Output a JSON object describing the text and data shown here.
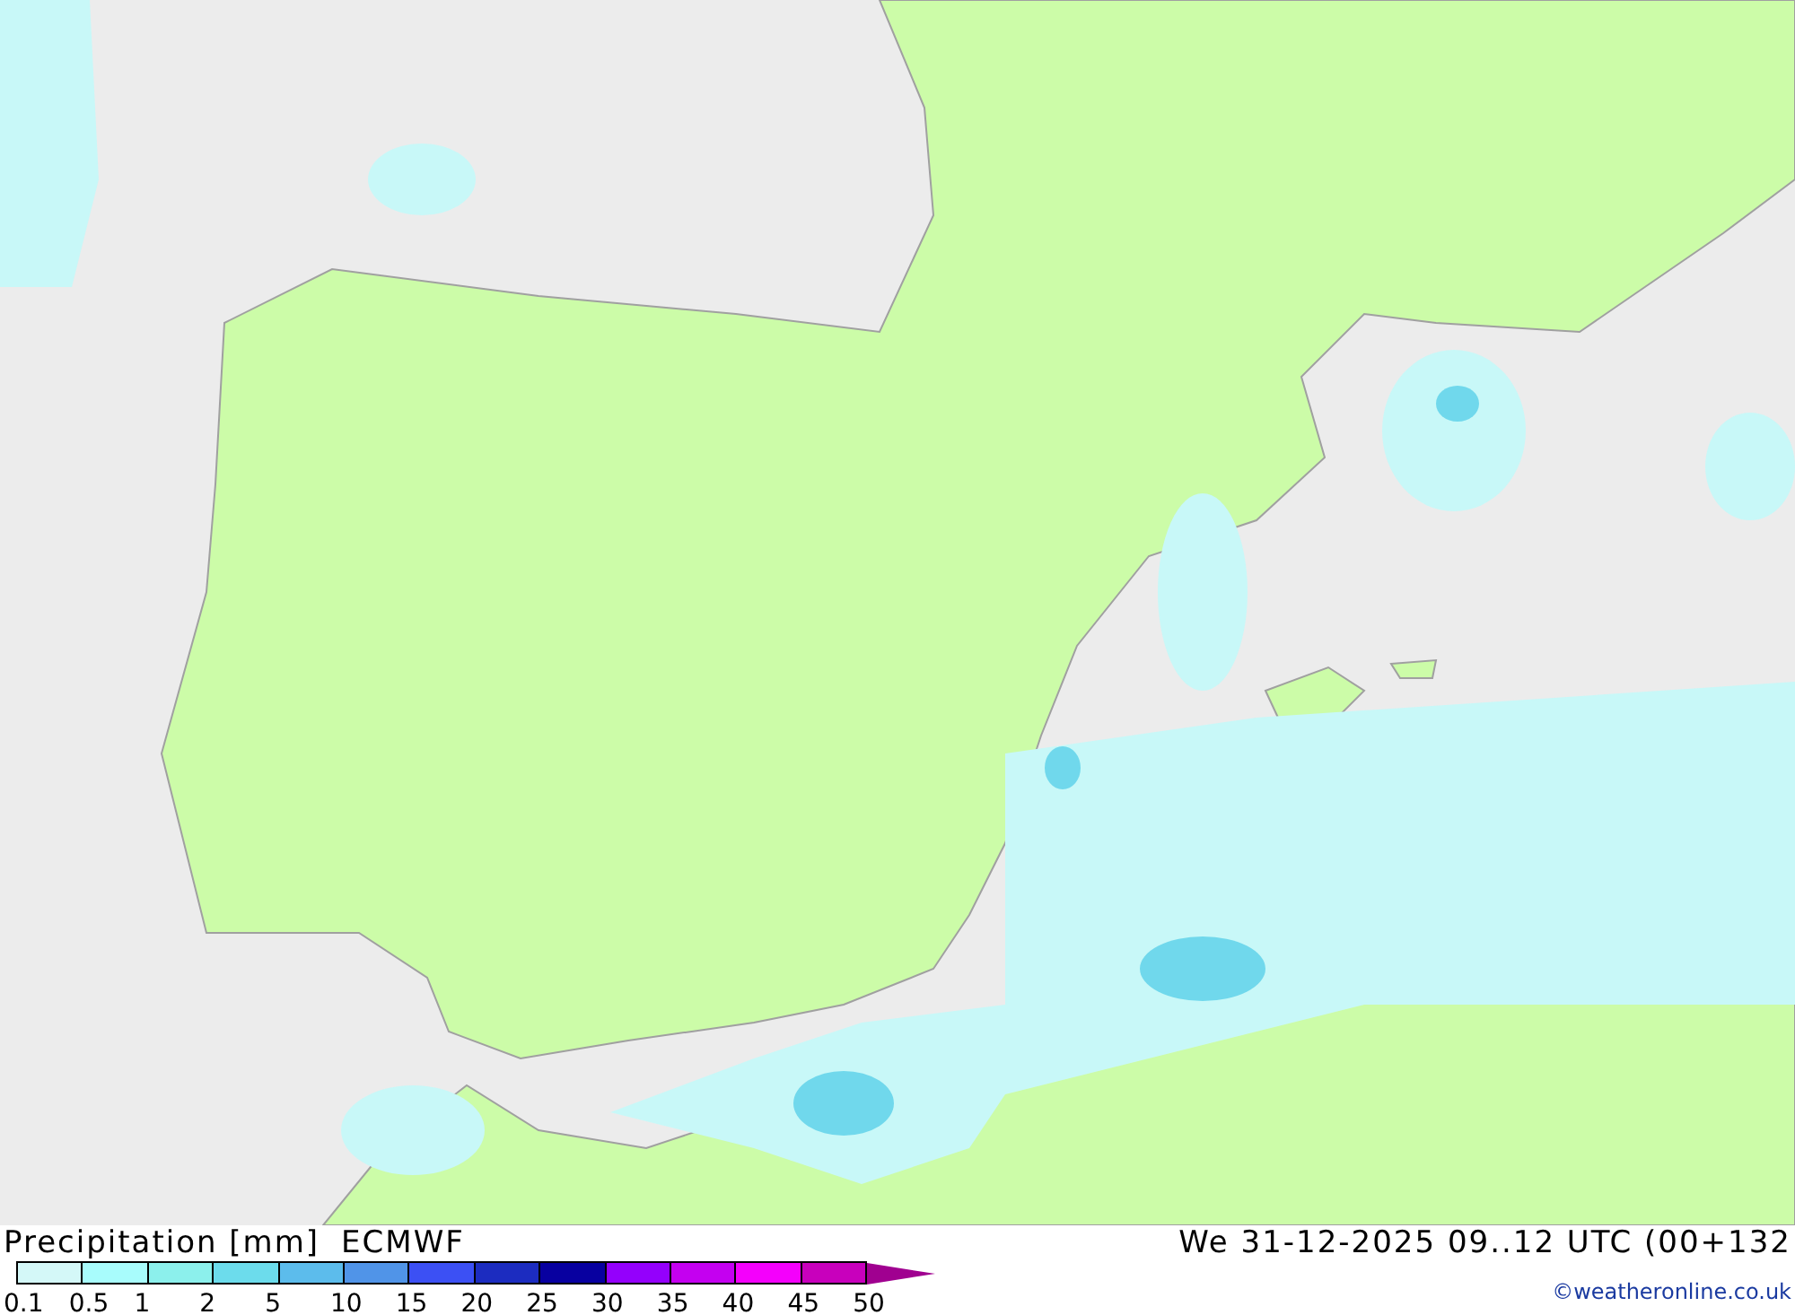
{
  "map": {
    "title": "Precipitation [mm]",
    "model": "ECMWF",
    "valid_time": "We 31-12-2025 09..12 UTC (00+132",
    "credit": "©weatheronline.co.uk"
  },
  "legend": {
    "swatches": [
      {
        "color": "#d4f8f8"
      },
      {
        "color": "#a8fcfc"
      },
      {
        "color": "#8cf0ec"
      },
      {
        "color": "#6cdcec"
      },
      {
        "color": "#5cbcec"
      },
      {
        "color": "#5094e8"
      },
      {
        "color": "#3c50f4"
      },
      {
        "color": "#1c2cc0"
      },
      {
        "color": "#0800a0"
      },
      {
        "color": "#9400fc"
      },
      {
        "color": "#c400f0"
      },
      {
        "color": "#f400fc"
      },
      {
        "color": "#c800bc"
      },
      {
        "kind": "arrow",
        "color": "#a00090"
      }
    ],
    "ticks": [
      "0.1",
      "0.5",
      "1",
      "2",
      "5",
      "10",
      "15",
      "20",
      "25",
      "30",
      "35",
      "40",
      "45",
      "50"
    ]
  }
}
